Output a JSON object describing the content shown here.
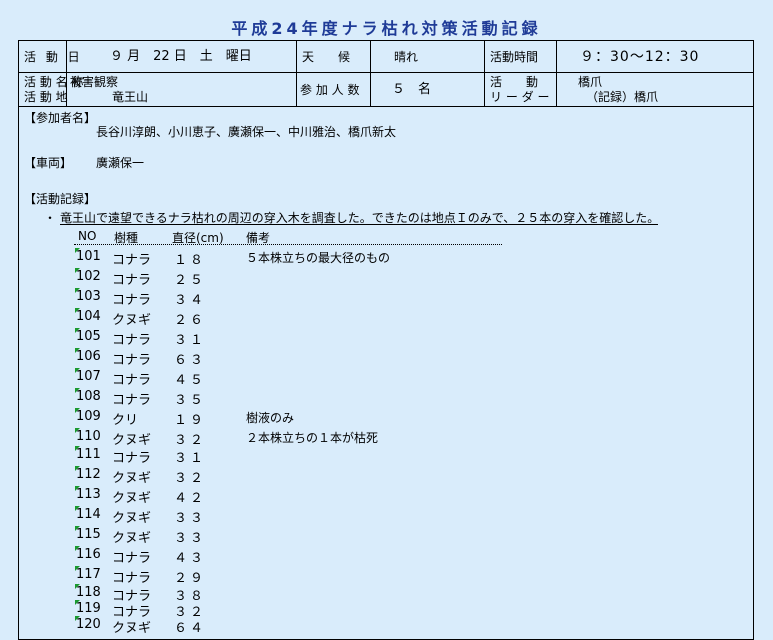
{
  "title": "平成24年度ナラ枯れ対策活動記録",
  "header": {
    "date_label": "活 動 日",
    "date_value": "９ 月　22 日　土　曜日",
    "weather_label": "天　　候",
    "weather_value": "晴れ",
    "time_label": "活動時間",
    "time_value": "９：30〜12：30",
    "name_label": "活 動 名 称",
    "name_value": "被害観察",
    "place_label": "活 動 地",
    "place_value": "竜王山",
    "count_label": "参 加 人 数",
    "count_value": "５　名",
    "leader_label1": "活　　動",
    "leader_label2": "リ ー ダ ー",
    "leader_value1": "橋爪",
    "leader_value2": "（記録）橋爪"
  },
  "participants": {
    "label": "【参加者名】",
    "names": "長谷川淳朗、小川恵子、廣瀬保一、中川雅治、橋爪新太"
  },
  "vehicle": {
    "label": "【車両】",
    "value": "廣瀬保一"
  },
  "record": {
    "label": "【活動記録】",
    "bullet": "・",
    "text": "竜王山で遠望できるナラ枯れの周辺の穿入木を調査した。できたのは地点Ｉのみで、２５本の穿入を確認した。"
  },
  "table": {
    "headers": [
      "NO",
      "樹種",
      "直径(cm)",
      "備考"
    ],
    "rows": [
      {
        "no": "101",
        "species": "コナラ",
        "dia": "１８",
        "note": "５本株立ちの最大径のもの"
      },
      {
        "no": "102",
        "species": "コナラ",
        "dia": "２５",
        "note": ""
      },
      {
        "no": "103",
        "species": "コナラ",
        "dia": "３４",
        "note": ""
      },
      {
        "no": "104",
        "species": "クヌギ",
        "dia": "２６",
        "note": ""
      },
      {
        "no": "105",
        "species": "コナラ",
        "dia": "３１",
        "note": ""
      },
      {
        "no": "106",
        "species": "コナラ",
        "dia": "６３",
        "note": ""
      },
      {
        "no": "107",
        "species": "コナラ",
        "dia": "４５",
        "note": ""
      },
      {
        "no": "108",
        "species": "コナラ",
        "dia": "３５",
        "note": ""
      },
      {
        "no": "109",
        "species": "クリ",
        "dia": "１９",
        "note": "樹液のみ"
      },
      {
        "no": "110",
        "species": "クヌギ",
        "dia": "３２",
        "note": "２本株立ちの１本が枯死"
      },
      {
        "no": "111",
        "species": "コナラ",
        "dia": "３１",
        "note": ""
      },
      {
        "no": "112",
        "species": "クヌギ",
        "dia": "３２",
        "note": ""
      },
      {
        "no": "113",
        "species": "クヌギ",
        "dia": "４２",
        "note": ""
      },
      {
        "no": "114",
        "species": "クヌギ",
        "dia": "３３",
        "note": ""
      },
      {
        "no": "115",
        "species": "クヌギ",
        "dia": "３３",
        "note": ""
      },
      {
        "no": "116",
        "species": "コナラ",
        "dia": "４３",
        "note": ""
      },
      {
        "no": "117",
        "species": "コナラ",
        "dia": "２９",
        "note": ""
      },
      {
        "no": "118",
        "species": "コナラ",
        "dia": "３８",
        "note": ""
      },
      {
        "no": "119",
        "species": "コナラ",
        "dia": "３２",
        "note": ""
      },
      {
        "no": "120",
        "species": "クヌギ",
        "dia": "６４",
        "note": ""
      }
    ]
  },
  "colors": {
    "background": "#d9ecfb",
    "title": "#1f3b97",
    "marker": "#1a9a30"
  }
}
